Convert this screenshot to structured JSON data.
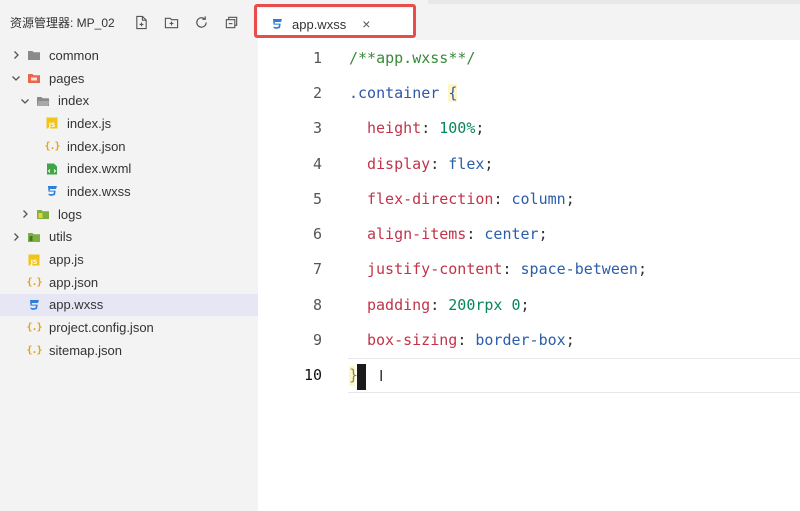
{
  "sidebar": {
    "title": "资源管理器: MP_02",
    "toolbar": [
      {
        "icon": "new-file-icon"
      },
      {
        "icon": "new-folder-icon"
      },
      {
        "icon": "refresh-icon"
      },
      {
        "icon": "collapse-all-icon"
      }
    ],
    "tree": [
      {
        "label": "common",
        "type": "folder",
        "expanded": false
      },
      {
        "label": "pages",
        "type": "folder",
        "expanded": true
      },
      {
        "label": "index",
        "type": "folder",
        "expanded": true
      },
      {
        "label": "index.js",
        "type": "js"
      },
      {
        "label": "index.json",
        "type": "json"
      },
      {
        "label": "index.wxml",
        "type": "wxml"
      },
      {
        "label": "index.wxss",
        "type": "wxss"
      },
      {
        "label": "logs",
        "type": "folder",
        "expanded": false
      },
      {
        "label": "utils",
        "type": "folder",
        "expanded": false
      },
      {
        "label": "app.js",
        "type": "js"
      },
      {
        "label": "app.json",
        "type": "json"
      },
      {
        "label": "app.wxss",
        "type": "wxss",
        "selected": true
      },
      {
        "label": "project.config.json",
        "type": "json"
      },
      {
        "label": "sitemap.json",
        "type": "json"
      }
    ]
  },
  "editor": {
    "tab": {
      "label": "app.wxss",
      "close": "×"
    },
    "highlight_color": "#e84c4c",
    "lines": [
      {
        "n": "1",
        "comment": "/**app.wxss**/"
      },
      {
        "n": "2",
        "selector": ".container",
        "brace": "{"
      },
      {
        "n": "3",
        "prop": "height",
        "colon": ":",
        "value": "100%",
        "end": ";"
      },
      {
        "n": "4",
        "prop": "display",
        "colon": ":",
        "value": "flex",
        "end": ";"
      },
      {
        "n": "5",
        "prop": "flex-direction",
        "colon": ":",
        "value": "column",
        "end": ";"
      },
      {
        "n": "6",
        "prop": "align-items",
        "colon": ":",
        "value": "center",
        "end": ";"
      },
      {
        "n": "7",
        "prop": "justify-content",
        "colon": ":",
        "value": "space-between",
        "end": ";"
      },
      {
        "n": "8",
        "prop": "padding",
        "colon": ":",
        "value": "200rpx 0",
        "end": ";"
      },
      {
        "n": "9",
        "prop": "box-sizing",
        "colon": ":",
        "value": "border-box",
        "end": ";"
      },
      {
        "n": "10",
        "closing": "}"
      }
    ]
  },
  "colors": {
    "comment": "#3a8a3a",
    "selector": "#2f57a8",
    "property": "#c1344a",
    "value": "#2a5daa",
    "number": "#098658",
    "js_icon": "#f0c419",
    "json_icon": "#e3a21a",
    "wxml_icon": "#41a349",
    "wxss_icon": "#2f7ed8"
  }
}
